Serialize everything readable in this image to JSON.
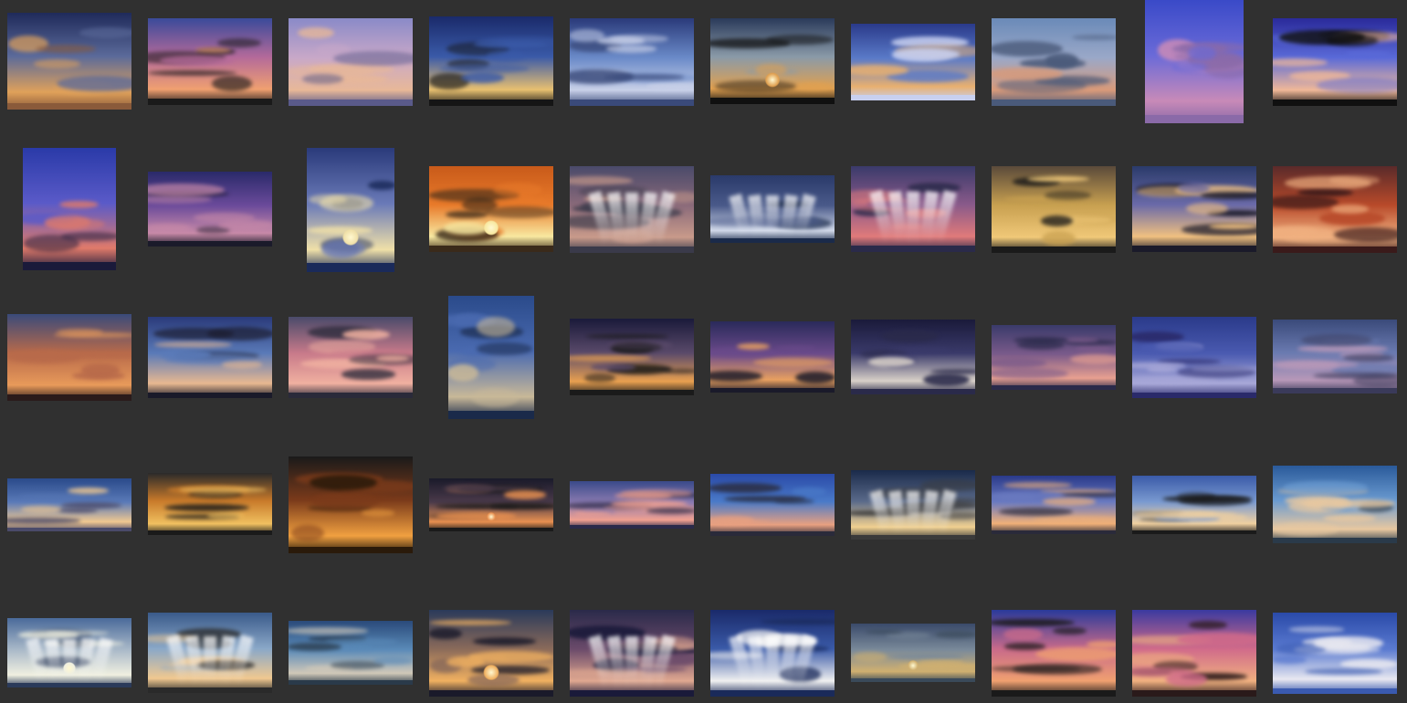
{
  "gallery": {
    "background": "#303030",
    "thumbnails": [
      {
        "style": "dusk-gold",
        "colors": [
          "#1f2a5a",
          "#5b6a9a",
          "#e0a15a",
          "#8a5a3a"
        ]
      },
      {
        "style": "pink-dusk",
        "colors": [
          "#3a4a9a",
          "#b46a9a",
          "#f0a070",
          "#1a1a1a"
        ]
      },
      {
        "style": "lenticular",
        "colors": [
          "#8a8ac8",
          "#c8a8c8",
          "#e8b898",
          "#5a5a8a"
        ]
      },
      {
        "style": "blue-cumulus",
        "colors": [
          "#1a2a6a",
          "#3a5aa8",
          "#e8c070",
          "#151515"
        ]
      },
      {
        "style": "ufo-cloud",
        "colors": [
          "#2a3a7a",
          "#6a8ac8",
          "#c8d0e8",
          "#3a4a7a"
        ]
      },
      {
        "style": "storm-sunset",
        "colors": [
          "#2a3a5a",
          "#8a9aa8",
          "#e0a050",
          "#101010"
        ]
      },
      {
        "style": "streaks",
        "colors": [
          "#2a3a8a",
          "#5a7ac8",
          "#e8b070",
          "#c8d0f0"
        ]
      },
      {
        "style": "lenticular-pink",
        "colors": [
          "#6a8ab8",
          "#9aa8c8",
          "#d89a7a",
          "#4a5a7a"
        ]
      },
      {
        "style": "violet-portrait",
        "colors": [
          "#3a4ac8",
          "#6a6ad8",
          "#c88ab8",
          "#8a6aa8"
        ]
      },
      {
        "style": "altocumulus",
        "colors": [
          "#2a2a9a",
          "#5a6ad8",
          "#f0b898",
          "#101010"
        ]
      },
      {
        "style": "violet-portrait",
        "colors": [
          "#2a3aa8",
          "#5a5ac8",
          "#e07a6a",
          "#1a1a3a"
        ]
      },
      {
        "style": "purple-mackerel",
        "colors": [
          "#2a2a6a",
          "#6a4a9a",
          "#c88aa8",
          "#1a1a2a"
        ]
      },
      {
        "style": "sea-portrait",
        "colors": [
          "#2a3a7a",
          "#6a7ab8",
          "#f0e0a8",
          "#1a2a5a"
        ]
      },
      {
        "style": "orange-sun",
        "colors": [
          "#c85a1a",
          "#e87a2a",
          "#f8e8a0",
          "#3a2a1a"
        ]
      },
      {
        "style": "rays-dusk",
        "colors": [
          "#4a4a6a",
          "#8a6a7a",
          "#c89a8a",
          "#3a3a4a"
        ]
      },
      {
        "style": "rays-blue",
        "colors": [
          "#2a3a6a",
          "#4a5a8a",
          "#d0d8e8",
          "#1a2a4a"
        ]
      },
      {
        "style": "rays-pink",
        "colors": [
          "#3a3a6a",
          "#8a5a8a",
          "#e07a7a",
          "#2a2a4a"
        ]
      },
      {
        "style": "golden-cloud",
        "colors": [
          "#5a4a3a",
          "#c8a050",
          "#f0c878",
          "#1a1a1a"
        ]
      },
      {
        "style": "stripe-violet",
        "colors": [
          "#2a3a6a",
          "#6a6aa8",
          "#f0c080",
          "#1a1a2a"
        ]
      },
      {
        "style": "red-sky",
        "colors": [
          "#5a2a2a",
          "#b84a2a",
          "#f0b080",
          "#3a1a1a"
        ]
      },
      {
        "style": "dusk-orange",
        "colors": [
          "#3a4a7a",
          "#b86a4a",
          "#e89a5a",
          "#2a1a1a"
        ]
      },
      {
        "style": "blue-evening",
        "colors": [
          "#2a3a7a",
          "#5a7ab8",
          "#e8b890",
          "#1a1a2a"
        ]
      },
      {
        "style": "pink-clouds",
        "colors": [
          "#4a4a6a",
          "#c87a8a",
          "#f0b0a0",
          "#2a2a3a"
        ]
      },
      {
        "style": "blue-portrait",
        "colors": [
          "#2a4a8a",
          "#4a6ab0",
          "#c8b898",
          "#1a2a4a"
        ]
      },
      {
        "style": "dark-orange",
        "colors": [
          "#1a1a3a",
          "#5a4a6a",
          "#e8a050",
          "#1a1a1a"
        ]
      },
      {
        "style": "purple-orange",
        "colors": [
          "#2a2a5a",
          "#6a4a8a",
          "#e8a060",
          "#1a1a2a"
        ]
      },
      {
        "style": "storm-light",
        "colors": [
          "#1a1a3a",
          "#3a3a6a",
          "#d8d0c8",
          "#2a2a4a"
        ]
      },
      {
        "style": "pink-swirl",
        "colors": [
          "#3a3a6a",
          "#7a5a8a",
          "#e8a090",
          "#2a2a4a"
        ]
      },
      {
        "style": "blue-wisps",
        "colors": [
          "#2a3a8a",
          "#4a5ab0",
          "#a8a8d8",
          "#2a2a6a"
        ]
      },
      {
        "style": "violet-haze",
        "colors": [
          "#3a4a7a",
          "#6a7ab0",
          "#b898b8",
          "#3a3a5a"
        ]
      },
      {
        "style": "blue-wisps-gold",
        "colors": [
          "#2a4a8a",
          "#5a7ab8",
          "#f0c890",
          "#4a4a6a"
        ]
      },
      {
        "style": "golden-band",
        "colors": [
          "#2a2a2a",
          "#c87a2a",
          "#f0c060",
          "#1a1a1a"
        ]
      },
      {
        "style": "fiery",
        "colors": [
          "#1a1a1a",
          "#7a3a1a",
          "#f0a040",
          "#2a1a0a"
        ]
      },
      {
        "style": "dark-sunset",
        "colors": [
          "#1a1a2a",
          "#4a3a4a",
          "#e89050",
          "#1a1a1a"
        ]
      },
      {
        "style": "pastel-band",
        "colors": [
          "#3a4a8a",
          "#8a7ab0",
          "#f0a090",
          "#2a2a4a"
        ]
      },
      {
        "style": "clear-blue",
        "colors": [
          "#2a4aa8",
          "#4a7ac8",
          "#e8a080",
          "#2a2a3a"
        ]
      },
      {
        "style": "rays-gold",
        "colors": [
          "#1a2a4a",
          "#5a6a8a",
          "#f0d090",
          "#3a3a3a"
        ]
      },
      {
        "style": "layered-stripes",
        "colors": [
          "#2a3a8a",
          "#6a7ac0",
          "#f0b078",
          "#2a2a3a"
        ]
      },
      {
        "style": "blue-streak",
        "colors": [
          "#3a5aa8",
          "#7a9ad0",
          "#f0d0a0",
          "#1a1a1a"
        ]
      },
      {
        "style": "mackerel-blue",
        "colors": [
          "#2a5a9a",
          "#6a9ad0",
          "#e8c8a0",
          "#2a3a4a"
        ]
      },
      {
        "style": "sun-rays",
        "colors": [
          "#4a6a9a",
          "#a8b8c8",
          "#f0f0e0",
          "#2a3a5a"
        ]
      },
      {
        "style": "fan-rays",
        "colors": [
          "#3a5a8a",
          "#8aa8c8",
          "#f0c890",
          "#2a2a2a"
        ]
      },
      {
        "style": "cirrus-blue",
        "colors": [
          "#2a4a7a",
          "#5a8ab8",
          "#d0c8b8",
          "#2a3a4a"
        ]
      },
      {
        "style": "golden-sea",
        "colors": [
          "#2a3a5a",
          "#8a6a5a",
          "#f0b060",
          "#1a1a2a"
        ]
      },
      {
        "style": "purple-rays",
        "colors": [
          "#2a2a4a",
          "#6a4a6a",
          "#e0a890",
          "#1a1a3a"
        ]
      },
      {
        "style": "bright-rays",
        "colors": [
          "#1a2a6a",
          "#3a5aa8",
          "#f0f0f0",
          "#1a2a5a"
        ]
      },
      {
        "style": "calm-sea",
        "colors": [
          "#3a4a6a",
          "#7a8a9a",
          "#d0b070",
          "#3a4a5a"
        ]
      },
      {
        "style": "vivid-pink",
        "colors": [
          "#2a3a9a",
          "#c86a8a",
          "#f0a070",
          "#1a1a1a"
        ]
      },
      {
        "style": "vivid-pink-2",
        "colors": [
          "#3a3aa0",
          "#d06a8a",
          "#f0b080",
          "#2a1a1a"
        ]
      },
      {
        "style": "ripple-cirrus",
        "colors": [
          "#2a4aa8",
          "#5a7ad0",
          "#e8e8f0",
          "#3a5ab0"
        ]
      }
    ]
  }
}
